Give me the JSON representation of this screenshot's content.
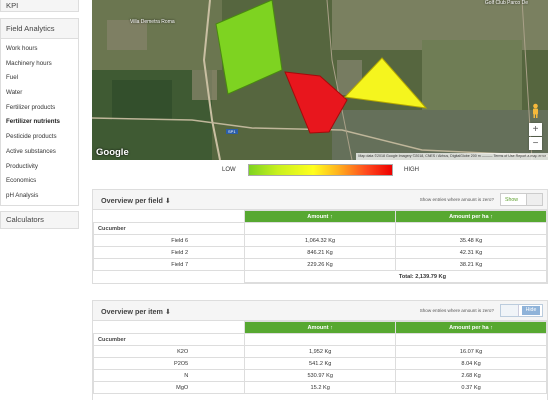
{
  "sidebar": {
    "kpi_label": "KPI",
    "field_analytics_label": "Field Analytics",
    "items": [
      {
        "label": "Work hours",
        "active": false
      },
      {
        "label": "Machinery hours",
        "active": false
      },
      {
        "label": "Fuel",
        "active": false
      },
      {
        "label": "Water",
        "active": false
      },
      {
        "label": "Fertilizer products",
        "active": false
      },
      {
        "label": "Fertilizer nutrients",
        "active": true
      },
      {
        "label": "Pesticide products",
        "active": false
      },
      {
        "label": "Active substances",
        "active": false
      },
      {
        "label": "Productivity",
        "active": false
      },
      {
        "label": "Economics",
        "active": false
      },
      {
        "label": "pH Analysis",
        "active": false
      }
    ],
    "calculators_label": "Calculators"
  },
  "map": {
    "place_label": "Villa Demetra Roma",
    "place_label_2": "Golf Club Parco De",
    "road_badge": "SP1",
    "google_logo": "Google",
    "attribution": "Map data ©2018 Google Imagery ©2018, CNES / Airbus, DigitalGlobe   200 m  ———  Terms of Use   Report a map error",
    "zoom_in": "+",
    "zoom_out": "−",
    "colors": {
      "field_green": "#7ed321",
      "field_red": "#e8161d",
      "field_yellow": "#f5f51e"
    }
  },
  "legend": {
    "low": "LOW",
    "high": "HIGH"
  },
  "overview_field": {
    "title": "Overview per field",
    "title_arrow": "⬇",
    "zero_label": "Show entries where amount is zero?",
    "toggle_label": "Show",
    "col_amount": "Amount ↑",
    "col_amount_ha": "Amount per ha ↑",
    "group": "Cucumber",
    "rows": [
      {
        "name": "Field 6",
        "amount": "1,064.32 Kg",
        "per_ha": "35.48 Kg"
      },
      {
        "name": "Field 2",
        "amount": "846.21 Kg",
        "per_ha": "42.31 Kg"
      },
      {
        "name": "Field 7",
        "amount": "229.26 Kg",
        "per_ha": "38.21 Kg"
      }
    ],
    "total": "Total: 2,139.79 Kg"
  },
  "overview_item": {
    "title": "Overview per item",
    "title_arrow": "⬇",
    "zero_label": "Show entries where amount is zero?",
    "toggle_label": "Hide",
    "col_amount": "Amount ↑",
    "col_amount_ha": "Amount per ha ↑",
    "group": "Cucumber",
    "rows": [
      {
        "name": "K2O",
        "amount": "1,952 Kg",
        "per_ha": "16.07 Kg"
      },
      {
        "name": "P2O5",
        "amount": "541.2 Kg",
        "per_ha": "8.04 Kg"
      },
      {
        "name": "N",
        "amount": "530.97 Kg",
        "per_ha": "2.68 Kg"
      },
      {
        "name": "MgO",
        "amount": "15.2 Kg",
        "per_ha": "0.37 Kg"
      }
    ]
  }
}
